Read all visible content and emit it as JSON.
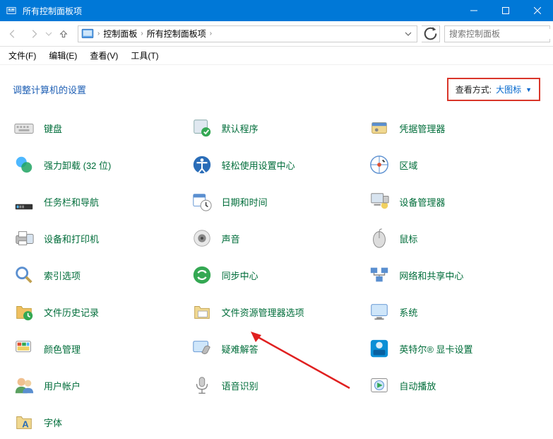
{
  "titlebar": {
    "title": "所有控制面板项"
  },
  "navbar": {
    "crumbs": [
      "控制面板",
      "所有控制面板项"
    ],
    "search_placeholder": "搜索控制面板"
  },
  "menubar": {
    "file": "文件(F)",
    "edit": "编辑(E)",
    "view": "查看(V)",
    "tools": "工具(T)"
  },
  "heading": "调整计算机的设置",
  "viewmode": {
    "label": "查看方式:",
    "value": "大图标"
  },
  "items": [
    {
      "id": "keyboard",
      "label": "键盘"
    },
    {
      "id": "default-programs",
      "label": "默认程序"
    },
    {
      "id": "credential-manager",
      "label": "凭据管理器"
    },
    {
      "id": "force-uninstall",
      "label": "强力卸载 (32 位)"
    },
    {
      "id": "ease-of-access",
      "label": "轻松使用设置中心"
    },
    {
      "id": "region",
      "label": "区域"
    },
    {
      "id": "taskbar-navigation",
      "label": "任务栏和导航"
    },
    {
      "id": "date-time",
      "label": "日期和时间"
    },
    {
      "id": "device-manager",
      "label": "设备管理器"
    },
    {
      "id": "devices-printers",
      "label": "设备和打印机"
    },
    {
      "id": "sound",
      "label": "声音"
    },
    {
      "id": "mouse",
      "label": "鼠标"
    },
    {
      "id": "indexing-options",
      "label": "索引选项"
    },
    {
      "id": "sync-center",
      "label": "同步中心"
    },
    {
      "id": "network-sharing",
      "label": "网络和共享中心"
    },
    {
      "id": "file-history",
      "label": "文件历史记录"
    },
    {
      "id": "explorer-options",
      "label": "文件资源管理器选项"
    },
    {
      "id": "system",
      "label": "系统"
    },
    {
      "id": "color-management",
      "label": "颜色管理"
    },
    {
      "id": "troubleshooting",
      "label": "疑难解答"
    },
    {
      "id": "intel-graphics",
      "label": "英特尔® 显卡设置"
    },
    {
      "id": "user-accounts",
      "label": "用户帐户"
    },
    {
      "id": "speech-recognition",
      "label": "语音识别"
    },
    {
      "id": "autoplay",
      "label": "自动播放"
    },
    {
      "id": "fonts",
      "label": "字体"
    }
  ]
}
